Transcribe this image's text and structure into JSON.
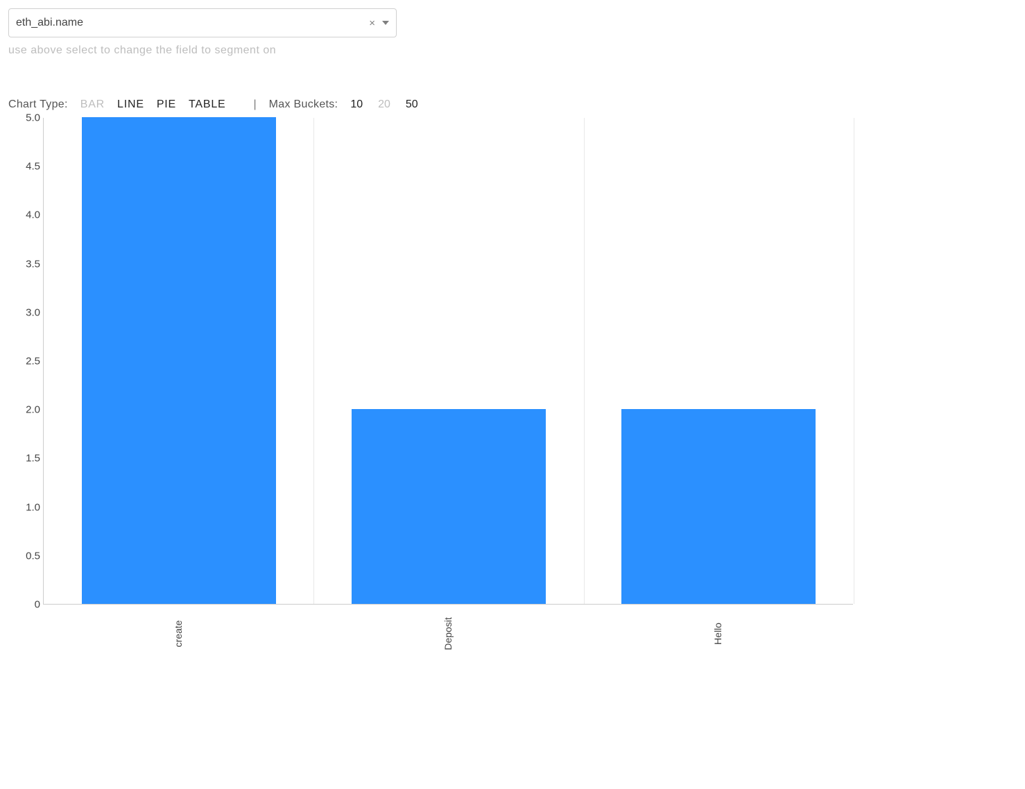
{
  "select": {
    "value": "eth_abi.name"
  },
  "hint": "use above select to change the field to segment on",
  "controls": {
    "chart_type_label": "Chart Type:",
    "types": [
      "BAR",
      "LINE",
      "PIE",
      "TABLE"
    ],
    "active_type": "BAR",
    "max_buckets_label": "Max Buckets:",
    "buckets": [
      "10",
      "20",
      "50"
    ],
    "active_bucket": "20"
  },
  "chart_data": {
    "type": "bar",
    "categories": [
      "create",
      "Deposit",
      "Hello"
    ],
    "values": [
      5,
      2,
      2
    ],
    "title": "",
    "xlabel": "",
    "ylabel": "",
    "ylim": [
      0,
      5
    ],
    "y_ticks": [
      0,
      0.5,
      1.0,
      1.5,
      2.0,
      2.5,
      3.0,
      3.5,
      4.0,
      4.5,
      5.0
    ],
    "y_tick_labels": [
      "0",
      "0.5",
      "1.0",
      "1.5",
      "2.0",
      "2.5",
      "3.0",
      "3.5",
      "4.0",
      "4.5",
      "5.0"
    ],
    "bar_color": "#2b90ff"
  }
}
